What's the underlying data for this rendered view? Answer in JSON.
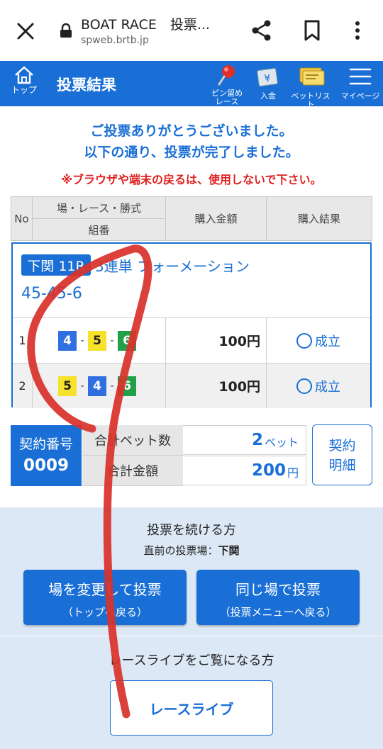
{
  "browser": {
    "title": "BOAT RACE　投票...",
    "url": "spweb.brtb.jp"
  },
  "nav": {
    "top_label": "トップ",
    "page_title": "投票結果",
    "pin_label_1": "ピン留め",
    "pin_label_2": "レース",
    "deposit_label": "入金",
    "betlist_label": "ベットリスト",
    "mypage_label": "マイページ"
  },
  "messages": {
    "thanks": "ご投票ありがとうございました。",
    "complete": "以下の通り、投票が完了しました。",
    "warning": "※ブラウザや端末の戻るは、使用しないで下さい。"
  },
  "table_header": {
    "no": "No",
    "race": "場・レース・勝式",
    "combo": "組番",
    "amount": "購入金額",
    "result": "購入結果"
  },
  "bet": {
    "venue_race": "下関 11R",
    "type": "3連単 フォーメーション",
    "combo": "45-45-6",
    "rows": [
      {
        "no": "1",
        "b1": "4",
        "b2": "5",
        "b3": "6",
        "amount": "100円",
        "result": "成立"
      },
      {
        "no": "2",
        "b1": "5",
        "b2": "4",
        "b3": "6",
        "amount": "100円",
        "result": "成立"
      }
    ],
    "dash": "-"
  },
  "summary": {
    "contract_label": "契約番号",
    "contract_no": "0009",
    "bet_count_label": "合計ベット数",
    "bet_count": "2",
    "bet_count_unit": "ベット",
    "total_label": "合計金額",
    "total": "200",
    "total_unit": "円",
    "detail_line1": "契約",
    "detail_line2": "明細"
  },
  "continue": {
    "title": "投票を続ける方",
    "last_venue_label": "直前の投票場：",
    "last_venue": "下関",
    "change_main": "場を変更して投票",
    "change_sub": "（トップへ戻る）",
    "same_main": "同じ場で投票",
    "same_sub": "（投票メニューへ戻る）"
  },
  "live": {
    "title": "レースライブをご覧になる方",
    "button": "レースライブ"
  },
  "colors": {
    "accent": "#1a6fd6",
    "warning": "#e02020",
    "panel_bg": "#dce8f6",
    "boat_4": "#2f6fe0",
    "boat_5": "#f7e22b",
    "boat_6": "#22a04a",
    "scribble": "#d9312b"
  }
}
